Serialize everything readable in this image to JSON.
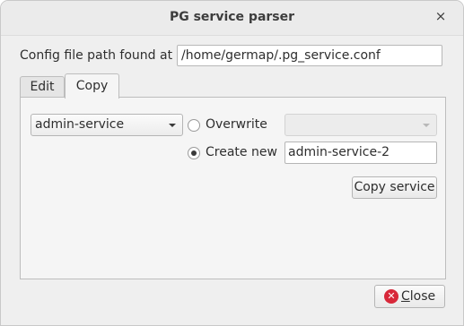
{
  "window": {
    "title": "PG service parser",
    "close_glyph": "×"
  },
  "config": {
    "label": "Config file path found at",
    "path_value": "/home/germap/.pg_service.conf"
  },
  "tabs": [
    {
      "label": "Edit",
      "selected": false
    },
    {
      "label": "Copy",
      "selected": true
    }
  ],
  "copy_tab": {
    "source_service": "admin-service",
    "overwrite_label": "Overwrite",
    "overwrite_selected": false,
    "overwrite_target": "",
    "create_new_label": "Create new",
    "create_new_selected": true,
    "new_service_name": "admin-service-2",
    "copy_button_label": "Copy service"
  },
  "footer": {
    "close_button_mnemonic": "C",
    "close_button_rest": "lose",
    "close_icon": "close-icon"
  },
  "colors": {
    "close_icon_red": "#d8283a"
  }
}
